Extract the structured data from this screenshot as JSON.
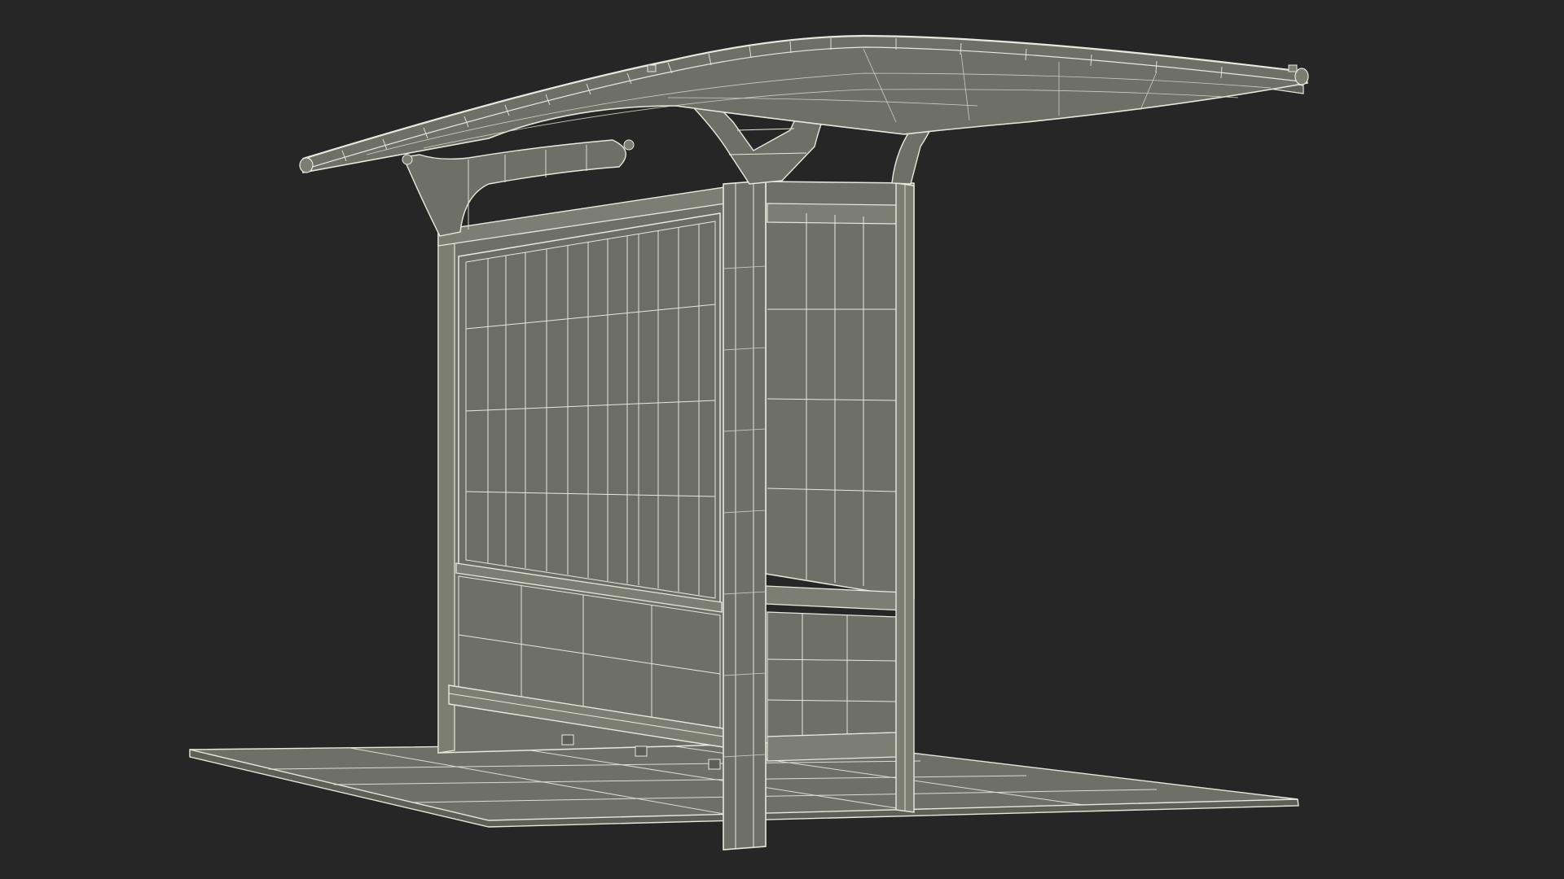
{
  "scene": {
    "subject": "bus-stop-shelter",
    "render_style": "wireframe",
    "colors": {
      "background": "#262626",
      "surface": "#6e6f66",
      "surface_dark": "#5e5f57",
      "surface_light": "#7c7d73",
      "wire": "#e9e8dc",
      "wire_soft": "#cfcdbf"
    },
    "parts": [
      "ground-slab",
      "canopy-roof",
      "roof-support-arm-left",
      "roof-support-arm-center",
      "roof-support-arm-right",
      "back-wall-panel",
      "front-corner-post",
      "side-panel-upper",
      "side-panel-lower",
      "rear-post",
      "bench-rail"
    ]
  }
}
